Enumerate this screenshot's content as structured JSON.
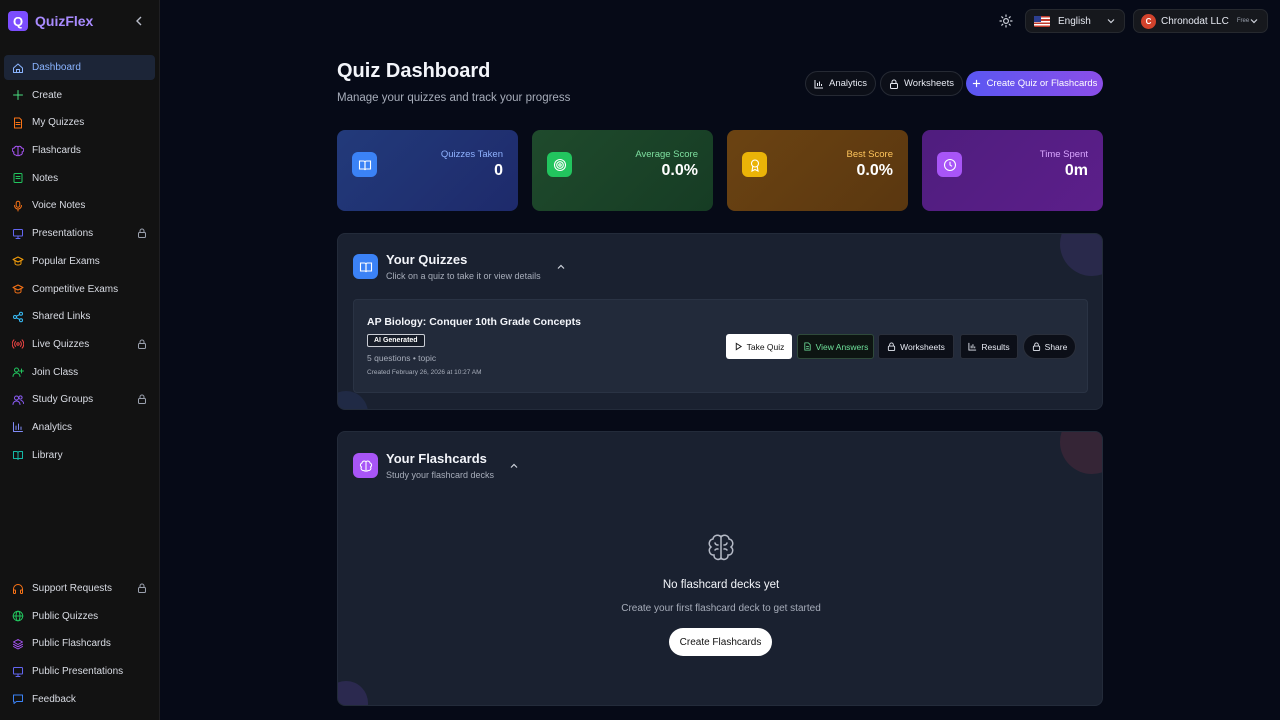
{
  "brand": {
    "logo_letter": "Q",
    "name": "QuizFlex"
  },
  "sidebar": {
    "items": [
      {
        "label": "Dashboard",
        "icon": "home-icon",
        "color": "#8ab4ff",
        "locked": false,
        "active": true
      },
      {
        "label": "Create",
        "icon": "plus-icon",
        "color": "#4ade80",
        "locked": false
      },
      {
        "label": "My Quizzes",
        "icon": "file-icon",
        "color": "#f97316",
        "locked": false
      },
      {
        "label": "Flashcards",
        "icon": "brain-icon",
        "color": "#a855f7",
        "locked": false
      },
      {
        "label": "Notes",
        "icon": "note-icon",
        "color": "#22c55e",
        "locked": false
      },
      {
        "label": "Voice Notes",
        "icon": "mic-icon",
        "color": "#f97316",
        "locked": false
      },
      {
        "label": "Presentations",
        "icon": "presentation-icon",
        "color": "#6366f1",
        "locked": true
      },
      {
        "label": "Popular Exams",
        "icon": "graduation-cap-icon",
        "color": "#f59e0b",
        "locked": false
      },
      {
        "label": "Competitive Exams",
        "icon": "graduation-cap-icon",
        "color": "#f97316",
        "locked": false
      },
      {
        "label": "Shared Links",
        "icon": "share-icon",
        "color": "#38bdf8",
        "locked": false
      },
      {
        "label": "Live Quizzes",
        "icon": "broadcast-icon",
        "color": "#ef4444",
        "locked": true
      },
      {
        "label": "Join Class",
        "icon": "user-plus-icon",
        "color": "#22c55e",
        "locked": false
      },
      {
        "label": "Study Groups",
        "icon": "users-icon",
        "color": "#8b5cf6",
        "locked": true
      },
      {
        "label": "Analytics",
        "icon": "bar-chart-icon",
        "color": "#818cf8",
        "locked": false
      },
      {
        "label": "Library",
        "icon": "book-icon",
        "color": "#14b8a6",
        "locked": false
      }
    ],
    "bottom_items": [
      {
        "label": "Support Requests",
        "icon": "headphones-icon",
        "color": "#f97316",
        "locked": true
      },
      {
        "label": "Public Quizzes",
        "icon": "globe-icon",
        "color": "#22c55e",
        "locked": false
      },
      {
        "label": "Public Flashcards",
        "icon": "layers-icon",
        "color": "#a855f7",
        "locked": false
      },
      {
        "label": "Public Presentations",
        "icon": "presentation-icon",
        "color": "#6366f1",
        "locked": false
      },
      {
        "label": "Feedback",
        "icon": "message-icon",
        "color": "#3b82f6",
        "locked": false
      }
    ]
  },
  "topbar": {
    "language": "English",
    "user_initial": "C",
    "user_name": "Chronodat LLC",
    "plan": "Free"
  },
  "header": {
    "title": "Quiz Dashboard",
    "subtitle": "Manage your quizzes and track your progress",
    "analytics_label": "Analytics",
    "worksheets_label": "Worksheets",
    "create_label": "Create Quiz or Flashcards"
  },
  "stats": [
    {
      "label": "Quizzes Taken",
      "value": "0",
      "icon": "book-open-icon",
      "label_color": "#8fb2ff"
    },
    {
      "label": "Average Score",
      "value": "0.0%",
      "icon": "target-icon",
      "label_color": "#7ee0a0"
    },
    {
      "label": "Best Score",
      "value": "0.0%",
      "icon": "award-icon",
      "label_color": "#ffc65c"
    },
    {
      "label": "Time Spent",
      "value": "0m",
      "icon": "clock-icon",
      "label_color": "#d9a6ff"
    }
  ],
  "quizzes_section": {
    "title": "Your Quizzes",
    "subtitle": "Click on a quiz to take it or view details",
    "quiz": {
      "title": "AP Biology: Conquer 10th Grade Concepts",
      "badge": "AI Generated",
      "meta": "5 questions • topic",
      "created": "Created February 26, 2026 at 10:27 AM",
      "take_label": "Take Quiz",
      "answers_label": "View Answers",
      "worksheets_label": "Worksheets",
      "results_label": "Results",
      "share_label": "Share"
    }
  },
  "flashcards_section": {
    "title": "Your Flashcards",
    "subtitle": "Study your flashcard decks",
    "empty_title": "No flashcard decks yet",
    "empty_subtitle": "Create your first flashcard deck to get started",
    "empty_button": "Create Flashcards"
  }
}
